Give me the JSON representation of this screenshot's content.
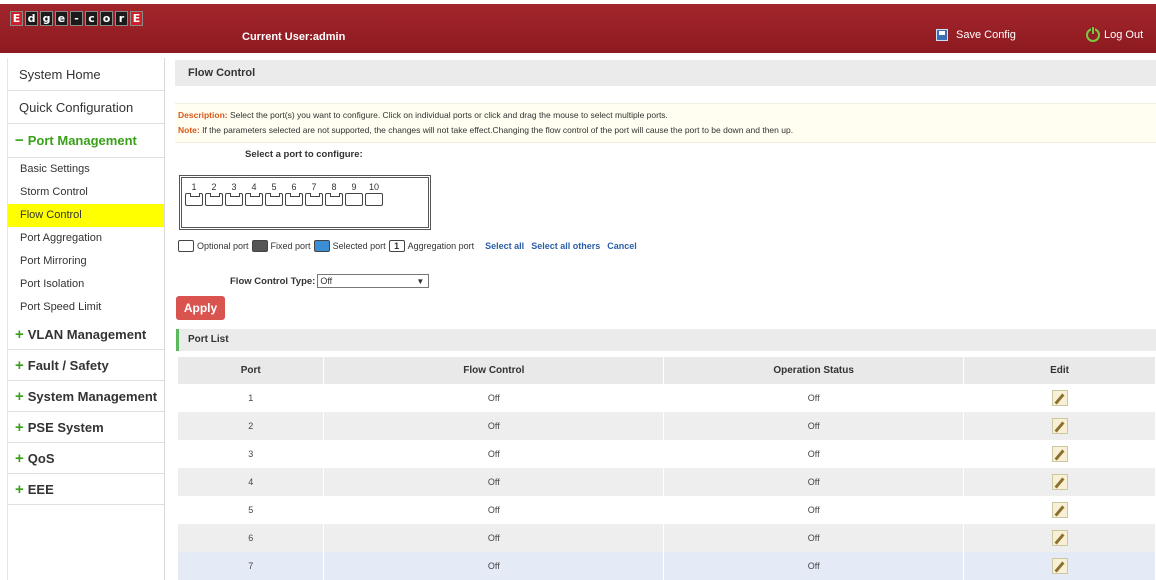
{
  "header": {
    "logo_letters": [
      "E",
      "d",
      "g",
      "e",
      "-",
      "c",
      "o",
      "r",
      "E"
    ],
    "current_user": "Current User:admin",
    "save_config": "Save Config",
    "log_out": "Log Out"
  },
  "sidebar": {
    "system_home": "System Home",
    "quick_config": "Quick Configuration",
    "port_management": "Port Management",
    "port_items": [
      "Basic Settings",
      "Storm Control",
      "Flow Control",
      "Port Aggregation",
      "Port Mirroring",
      "Port Isolation",
      "Port Speed Limit"
    ],
    "groups": [
      "VLAN Management",
      "Fault / Safety",
      "System Management",
      "PSE System",
      "QoS",
      "EEE"
    ],
    "open_marker": "−",
    "closed_marker": "+"
  },
  "main": {
    "title": "Flow Control",
    "description_label": "Description:",
    "description_text": " Select the port(s) you want to configure. Click on individual ports or click and drag the mouse to select multiple ports.",
    "note_label": "Note:",
    "note_text": " If the parameters selected are not supported, the changes will not take effect.Changing the flow control of the port will cause the port to be down and then up.",
    "select_title": "Select a port to configure:",
    "ports": [
      "1",
      "2",
      "3",
      "4",
      "5",
      "6",
      "7",
      "8",
      "9",
      "10"
    ],
    "legend": {
      "optional": "Optional port",
      "fixed": "Fixed port",
      "selected": "Selected port",
      "aggregation": "Aggregation port",
      "aggregation_num": "1",
      "select_all": "Select all",
      "select_all_others": "Select all others",
      "cancel": "Cancel"
    },
    "flow_control_type_label": "Flow Control Type:",
    "flow_control_type_value": "Off",
    "apply": "Apply",
    "port_list_title": "Port List",
    "table": {
      "headers": [
        "Port",
        "Flow Control",
        "Operation Status",
        "Edit"
      ],
      "rows": [
        [
          "1",
          "Off",
          "Off"
        ],
        [
          "2",
          "Off",
          "Off"
        ],
        [
          "3",
          "Off",
          "Off"
        ],
        [
          "4",
          "Off",
          "Off"
        ],
        [
          "5",
          "Off",
          "Off"
        ],
        [
          "6",
          "Off",
          "Off"
        ],
        [
          "7",
          "Off",
          "Off"
        ]
      ]
    }
  },
  "colors": {
    "header_bg": "#96202a",
    "active_item": "#ffff00",
    "apply_button": "#d9534f",
    "link": "#2c5ea8",
    "group_plus": "#3aa01a"
  }
}
